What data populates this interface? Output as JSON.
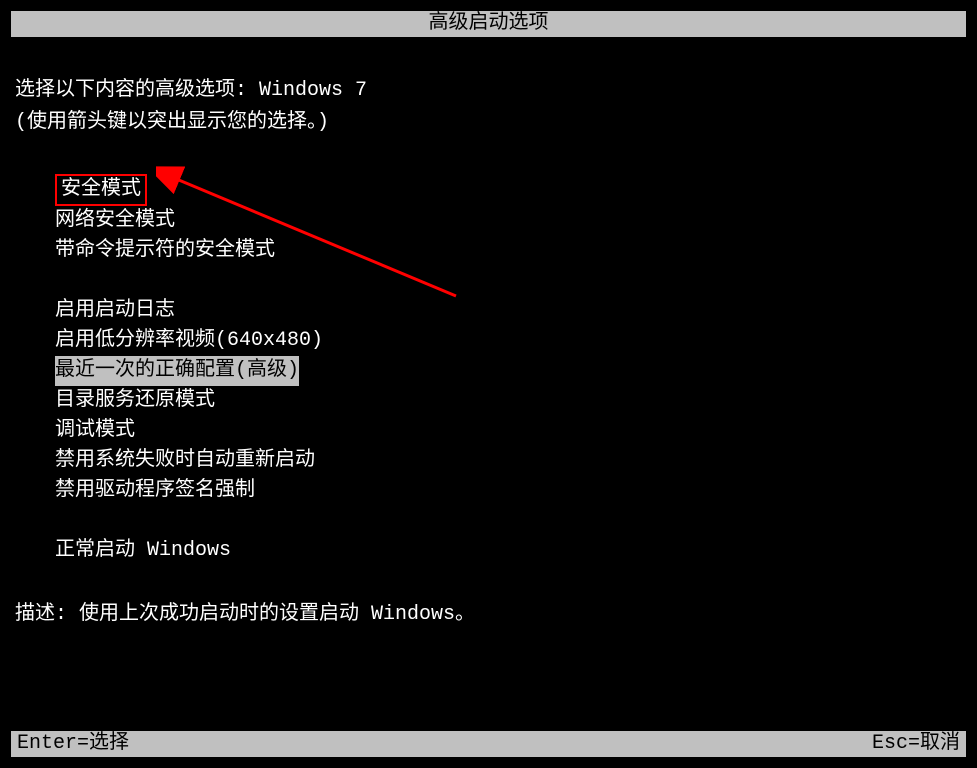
{
  "title": "高级启动选项",
  "prompt_prefix": "选择以下内容的高级选项: ",
  "os_name": "Windows 7",
  "hint": "(使用箭头键以突出显示您的选择。)",
  "options": {
    "group1": [
      "安全模式",
      "网络安全模式",
      "带命令提示符的安全模式"
    ],
    "group2": [
      "启用启动日志",
      "启用低分辨率视频(640x480)",
      "最近一次的正确配置(高级)",
      "目录服务还原模式",
      "调试模式",
      "禁用系统失败时自动重新启动",
      "禁用驱动程序签名强制"
    ],
    "group3": [
      "正常启动 Windows"
    ]
  },
  "highlighted_option": "安全模式",
  "selected_option": "最近一次的正确配置(高级)",
  "description_label": "描述: ",
  "description_text": "使用上次成功启动时的设置启动 Windows。",
  "footer": {
    "left": "Enter=选择",
    "right": "Esc=取消"
  }
}
